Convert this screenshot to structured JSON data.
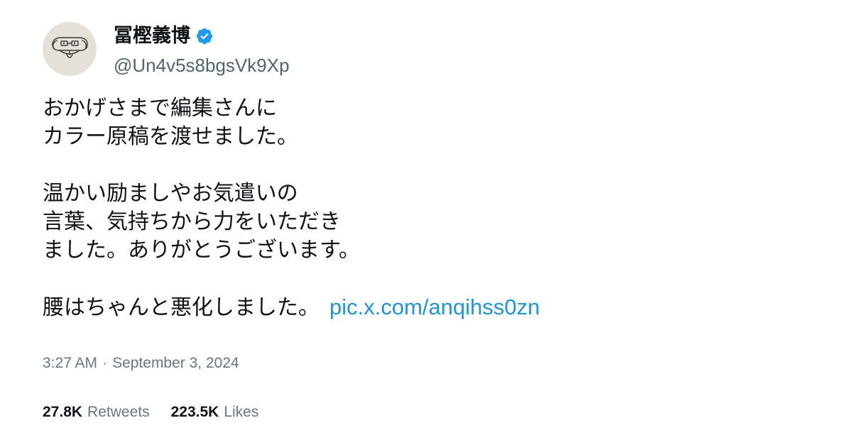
{
  "author": {
    "display_name": "冨樫義博",
    "handle": "@Un4v5s8bgsVk9Xp",
    "avatar_icon": "dog-sketch-avatar-icon",
    "verified_icon": "verified-badge-icon",
    "verified_color": "#1d9bf0"
  },
  "tweet": {
    "lines_1": [
      "おかげさまで編集さんに",
      "カラー原稿を渡せました。"
    ],
    "lines_2": [
      "温かい励ましやお気遣いの",
      "言葉、気持ちから力をいただき",
      "ました。ありがとうございます。"
    ],
    "last_text": "腰はちゃんと悪化しました。",
    "link": "pic.x.com/anqihss0zn",
    "link_color": "#1b95e0"
  },
  "meta": {
    "time": "3:27 AM",
    "separator": "·",
    "date": "September 3, 2024"
  },
  "stats": {
    "retweets_count": "27.8K",
    "retweets_label": "Retweets",
    "likes_count": "223.5K",
    "likes_label": "Likes"
  }
}
